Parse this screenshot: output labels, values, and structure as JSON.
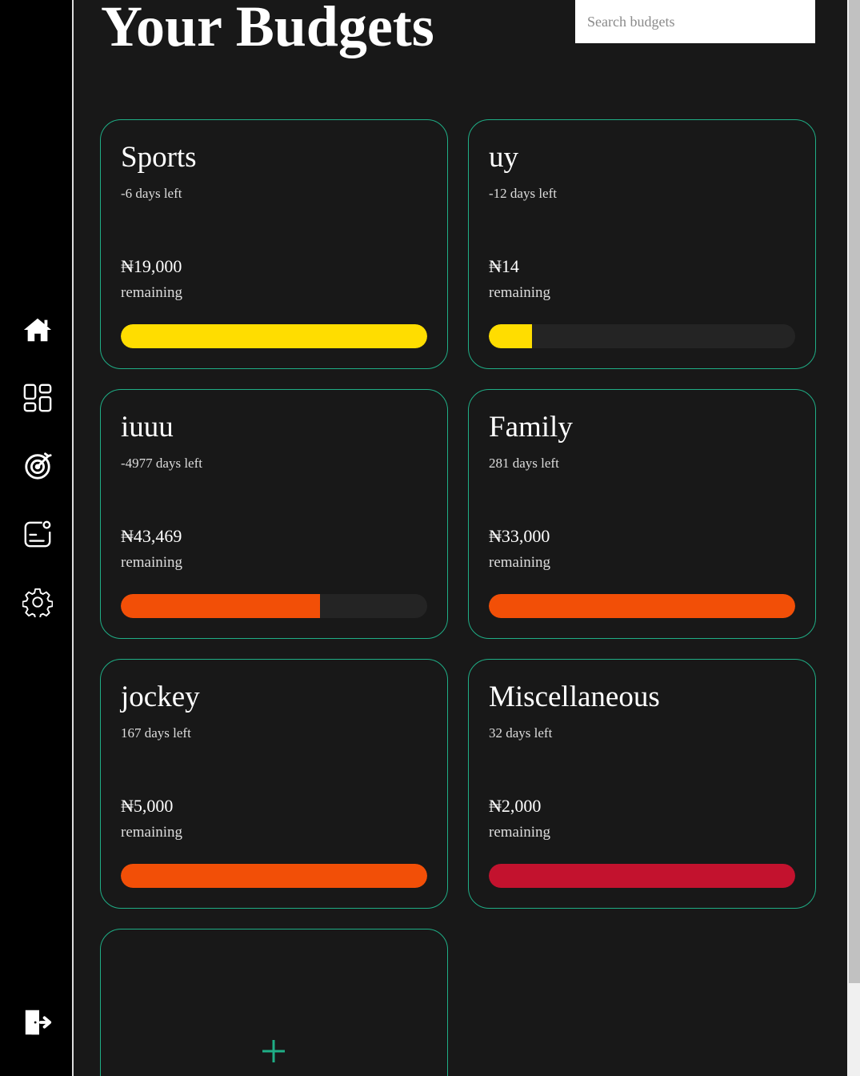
{
  "header": {
    "title": "Your Budgets",
    "search_placeholder": "Search budgets"
  },
  "sidebar": {
    "items": [
      {
        "icon": "home-icon"
      },
      {
        "icon": "dashboard-icon"
      },
      {
        "icon": "target-icon"
      },
      {
        "icon": "expenses-icon"
      },
      {
        "icon": "gear-icon"
      }
    ],
    "logout_icon": "logout-icon"
  },
  "colors": {
    "accent": "#1fae86",
    "yellow": "#ffdd00",
    "orange": "#f24f07",
    "red": "#c3122e",
    "track": "#242424"
  },
  "budgets": [
    {
      "name": "Sports",
      "days_left": "-6 days left",
      "amount": "₦19,000",
      "remaining_label": "remaining",
      "progress": 1.0,
      "color": "#ffdd00"
    },
    {
      "name": "uy",
      "days_left": "-12 days left",
      "amount": "₦14",
      "remaining_label": "remaining",
      "progress": 0.14,
      "color": "#ffdd00"
    },
    {
      "name": "iuuu",
      "days_left": "-4977 days left",
      "amount": "₦43,469",
      "remaining_label": "remaining",
      "progress": 0.65,
      "color": "#f24f07"
    },
    {
      "name": "Family",
      "days_left": "281 days left",
      "amount": "₦33,000",
      "remaining_label": "remaining",
      "progress": 1.0,
      "color": "#f24f07"
    },
    {
      "name": "jockey",
      "days_left": "167 days left",
      "amount": "₦5,000",
      "remaining_label": "remaining",
      "progress": 1.0,
      "color": "#f24f07"
    },
    {
      "name": "Miscellaneous",
      "days_left": "32 days left",
      "amount": "₦2,000",
      "remaining_label": "remaining",
      "progress": 1.0,
      "color": "#c3122e"
    }
  ],
  "add_card": {
    "icon": "plus-icon"
  }
}
